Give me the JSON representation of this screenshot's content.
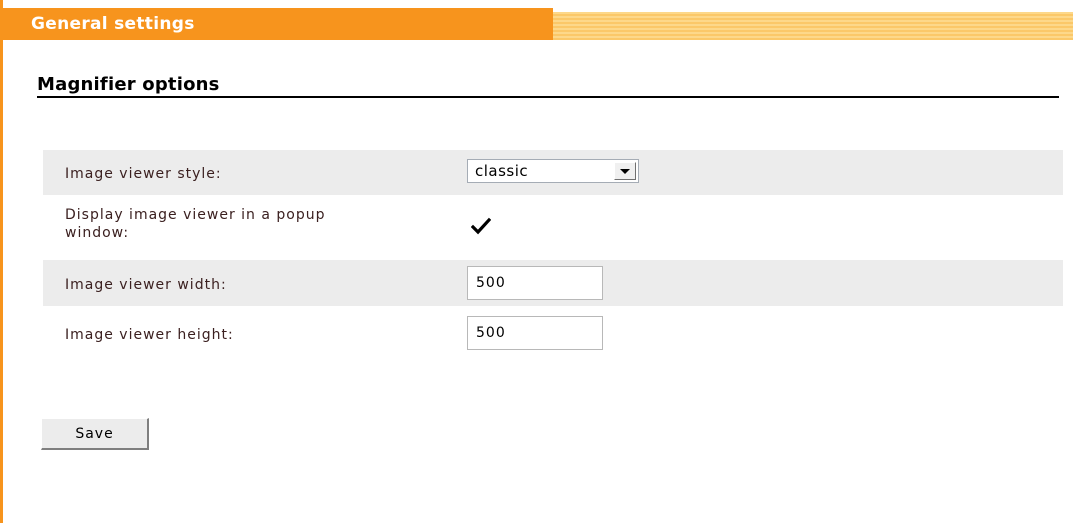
{
  "header": {
    "title": "General settings"
  },
  "section": {
    "title": "Magnifier options"
  },
  "form": {
    "viewer_style": {
      "label": "Image viewer style:",
      "selected": "classic"
    },
    "popup": {
      "label_line1": "Display image viewer in a popup",
      "label_line2": "window:",
      "checked": true
    },
    "width": {
      "label": "Image viewer width:",
      "value": "500"
    },
    "height": {
      "label": "Image viewer height:",
      "value": "500"
    }
  },
  "actions": {
    "save_label": "Save"
  },
  "colors": {
    "accent": "#f7941d",
    "header_stripes_light": "#fdd88a",
    "header_stripes_dark": "#fbc869",
    "row_shade": "#ececec",
    "label_text": "#3b2020"
  },
  "icons": {
    "checkbox": "checkmark-icon",
    "dropdown": "chevron-down-icon"
  }
}
